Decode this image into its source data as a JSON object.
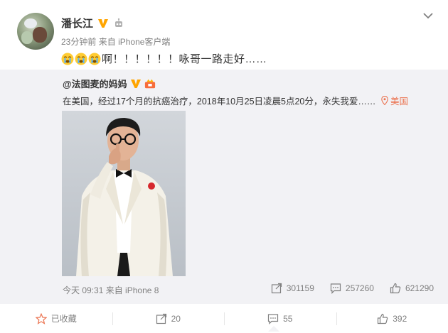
{
  "colors": {
    "accent": "#eb7350",
    "meta": "#808080",
    "text": "#333333",
    "repost_bg": "#f2f2f5",
    "verified": "#ffa500"
  },
  "post": {
    "author": "潘长江",
    "time": "23分钟前",
    "source_prefix": "来自",
    "source": "iPhone客户端",
    "emoji_icons": [
      "crying-face-icon",
      "crying-face-icon",
      "crying-face-icon"
    ],
    "text": "啊！！！！！！咏哥一路走好……"
  },
  "repost": {
    "author": "@法图麦的妈妈",
    "text": "在美国，经过17个月的抗癌治疗，2018年10月25日凌晨5点20分，永失我爱……",
    "location": "美国",
    "footer_time": "今天 09:31",
    "footer_source": "来自 iPhone 8",
    "reposts": "301159",
    "comments": "257260",
    "likes": "621290"
  },
  "actions": {
    "favorite": "已收藏",
    "forward": "20",
    "comment": "55",
    "like": "392"
  }
}
